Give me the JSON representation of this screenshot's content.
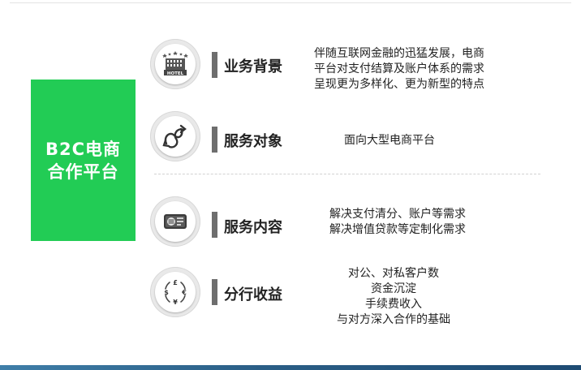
{
  "green_box": {
    "line1": "B2C电商",
    "line2": "合作平台",
    "color": "#22cc55"
  },
  "rows": [
    {
      "icon": "hotel-icon",
      "icon_text": "HOTEL",
      "label": "业务背景",
      "desc": [
        "伴随互联网金融的迅猛发展，电商",
        "平台对支付结算及账户体系的需求",
        "呈现更为多样化、更为新型的特点"
      ]
    },
    {
      "icon": "intertwined-arrows-icon",
      "label": "服务对象",
      "desc": [
        "面向大型电商平台"
      ]
    },
    {
      "icon": "card-reader-icon",
      "label": "服务内容",
      "desc": [
        "解决支付清分、账户等需求",
        "解决增值贷款等定制化需求"
      ]
    },
    {
      "icon": "currency-exchange-icon",
      "currency_symbols": [
        "£",
        "$",
        "€",
        "¥"
      ],
      "label": "分行收益",
      "desc": [
        "对公、对私客户数",
        "资金沉淀",
        "手续费收入",
        "与对方深入合作的基础"
      ]
    }
  ]
}
